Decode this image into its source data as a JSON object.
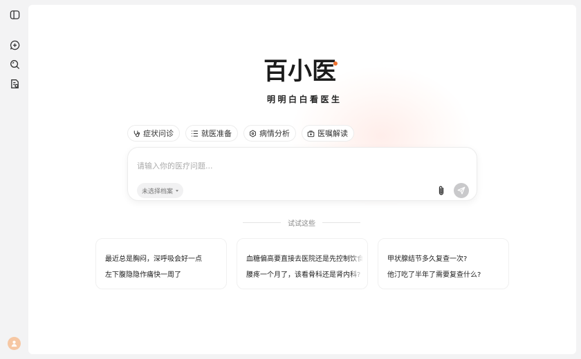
{
  "brand": {
    "logo_text": "百小医",
    "slogan": "明明白白看医生",
    "accent": "#f0722f"
  },
  "sidebar": {
    "items": [
      {
        "icon": "sidebar-toggle-icon"
      },
      {
        "icon": "new-chat-icon"
      },
      {
        "icon": "search-icon"
      },
      {
        "icon": "records-icon"
      }
    ],
    "avatar_icon": "user-icon"
  },
  "chips": [
    {
      "label": "症状问诊",
      "icon": "stethoscope-icon"
    },
    {
      "label": "就医准备",
      "icon": "checklist-icon"
    },
    {
      "label": "病情分析",
      "icon": "hexagon-icon"
    },
    {
      "label": "医嘱解读",
      "icon": "medkit-icon"
    }
  ],
  "input": {
    "placeholder": "请输入你的医疗问题...",
    "value": "",
    "profile_select": "未选择档案",
    "attach_icon": "paperclip-icon",
    "send_icon": "send-icon"
  },
  "suggestions": {
    "label": "试试这些",
    "cards": [
      {
        "q1": "最近总是胸闷，深呼吸会好一点",
        "q2": "左下腹隐隐作痛快一周了"
      },
      {
        "q1": "血糖偏高要直接去医院还是先控制饮食",
        "q2": "腰疼一个月了，该看骨科还是肾内科?"
      },
      {
        "q1": "甲状腺结节多久复查一次?",
        "q2": "他汀吃了半年了需要复查什么?"
      }
    ]
  }
}
